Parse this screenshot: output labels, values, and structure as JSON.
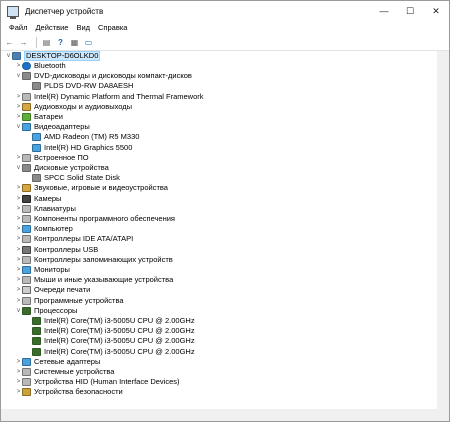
{
  "window": {
    "title": "Диспетчер устройств",
    "controls": [
      "—",
      "☐",
      "✕"
    ]
  },
  "menu": [
    "Файл",
    "Действие",
    "Вид",
    "Справка"
  ],
  "toolbar": [
    "back-icon",
    "forward-icon",
    "show-hide-console-tree-icon",
    "help-icon",
    "properties-icon",
    "monitor-icon"
  ],
  "tree": {
    "root": "DESKTOP-D6OLKD0",
    "items": [
      {
        "label": "Bluetooth",
        "icon": "bt",
        "level": 1,
        "expander": ">"
      },
      {
        "label": "DVD-дисководы и дисководы компакт-дисков",
        "icon": "disk",
        "level": 1,
        "expander": "v"
      },
      {
        "label": "PLDS DVD-RW DA8AESH",
        "icon": "disk",
        "level": 2,
        "expander": ""
      },
      {
        "label": "Intel(R) Dynamic Platform and Thermal Framework",
        "icon": "dev",
        "level": 1,
        "expander": ">"
      },
      {
        "label": "Аудиовходы и аудиовыходы",
        "icon": "speaker",
        "level": 1,
        "expander": ">"
      },
      {
        "label": "Батареи",
        "icon": "battery",
        "level": 1,
        "expander": ">"
      },
      {
        "label": "Видеоадаптеры",
        "icon": "monitor",
        "level": 1,
        "expander": "v"
      },
      {
        "label": "AMD Radeon (TM) R5 M330",
        "icon": "monitor",
        "level": 2,
        "expander": ""
      },
      {
        "label": "Intel(R) HD Graphics 5500",
        "icon": "monitor",
        "level": 2,
        "expander": ""
      },
      {
        "label": "Встроенное ПО",
        "icon": "dev",
        "level": 1,
        "expander": ">"
      },
      {
        "label": "Дисковые устройства",
        "icon": "disk",
        "level": 1,
        "expander": "v"
      },
      {
        "label": "SPCC Solid State Disk",
        "icon": "disk",
        "level": 2,
        "expander": ""
      },
      {
        "label": "Звуковые, игровые и видеоустройства",
        "icon": "speaker",
        "level": 1,
        "expander": ">"
      },
      {
        "label": "Камеры",
        "icon": "camera",
        "level": 1,
        "expander": ">"
      },
      {
        "label": "Клавиатуры",
        "icon": "keyboard",
        "level": 1,
        "expander": ">"
      },
      {
        "label": "Компоненты программного обеспечения",
        "icon": "dev",
        "level": 1,
        "expander": ">"
      },
      {
        "label": "Компьютер",
        "icon": "monitor",
        "level": 1,
        "expander": ">"
      },
      {
        "label": "Контроллеры IDE ATA/ATAPI",
        "icon": "dev",
        "level": 1,
        "expander": ">"
      },
      {
        "label": "Контроллеры USB",
        "icon": "usb",
        "level": 1,
        "expander": ">"
      },
      {
        "label": "Контроллеры запоминающих устройств",
        "icon": "dev",
        "level": 1,
        "expander": ">"
      },
      {
        "label": "Мониторы",
        "icon": "monitor",
        "level": 1,
        "expander": ">"
      },
      {
        "label": "Мыши и иные указывающие устройства",
        "icon": "dev",
        "level": 1,
        "expander": ">"
      },
      {
        "label": "Очереди печати",
        "icon": "print",
        "level": 1,
        "expander": ">"
      },
      {
        "label": "Программные устройства",
        "icon": "dev",
        "level": 1,
        "expander": ">"
      },
      {
        "label": "Процессоры",
        "icon": "cpu",
        "level": 1,
        "expander": "v"
      },
      {
        "label": "Intel(R) Core(TM) i3-5005U CPU @ 2.00GHz",
        "icon": "cpu",
        "level": 2,
        "expander": ""
      },
      {
        "label": "Intel(R) Core(TM) i3-5005U CPU @ 2.00GHz",
        "icon": "cpu",
        "level": 2,
        "expander": ""
      },
      {
        "label": "Intel(R) Core(TM) i3-5005U CPU @ 2.00GHz",
        "icon": "cpu",
        "level": 2,
        "expander": ""
      },
      {
        "label": "Intel(R) Core(TM) i3-5005U CPU @ 2.00GHz",
        "icon": "cpu",
        "level": 2,
        "expander": ""
      },
      {
        "label": "Сетевые адаптеры",
        "icon": "monitor",
        "level": 1,
        "expander": ">"
      },
      {
        "label": "Системные устройства",
        "icon": "dev",
        "level": 1,
        "expander": ">"
      },
      {
        "label": "Устройства HID (Human Interface Devices)",
        "icon": "dev",
        "level": 1,
        "expander": ">"
      },
      {
        "label": "Устройства безопасности",
        "icon": "lock",
        "level": 1,
        "expander": ">"
      }
    ]
  }
}
